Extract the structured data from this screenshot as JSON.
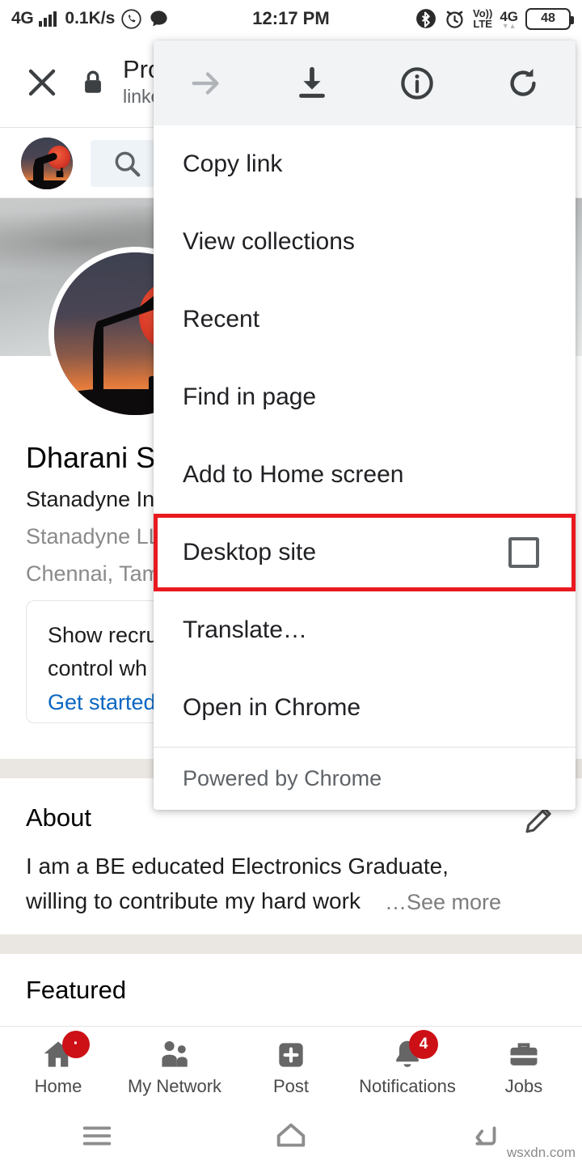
{
  "status_bar": {
    "network_type": "4G",
    "data_speed": "0.1K/s",
    "time": "12:17 PM",
    "volte_line1": "Vo))",
    "volte_line2": "LTE",
    "network_type_right": "4G",
    "battery_level": "48",
    "icons": [
      "signal-bars-icon",
      "whatsapp-icon",
      "message-bubble-icon",
      "bluetooth-icon",
      "alarm-clock-icon",
      "battery-icon"
    ]
  },
  "browser_header": {
    "close_label": "close-icon",
    "lock_label": "lock-icon",
    "page_title": "Pro",
    "page_url": "linke"
  },
  "menu": {
    "toolbar": [
      {
        "name": "forward-arrow-icon",
        "enabled": false
      },
      {
        "name": "download-icon",
        "enabled": true
      },
      {
        "name": "page-info-icon",
        "enabled": true
      },
      {
        "name": "refresh-icon",
        "enabled": true
      }
    ],
    "items": [
      {
        "label": "Copy link",
        "type": "item"
      },
      {
        "label": "View collections",
        "type": "item"
      },
      {
        "label": "Recent",
        "type": "item"
      },
      {
        "label": "Find in page",
        "type": "item"
      },
      {
        "label": "Add to Home screen",
        "type": "item"
      },
      {
        "label": "Desktop site",
        "type": "checkbox",
        "checked": false,
        "highlighted": true
      },
      {
        "label": "Translate…",
        "type": "item"
      },
      {
        "label": "Open in Chrome",
        "type": "item"
      }
    ],
    "footer": "Powered by Chrome",
    "highlight_color": "#e8191f"
  },
  "linkedin": {
    "search_placeholder": "search-icon",
    "profile": {
      "name": "Dharani S",
      "headline": "Stanadyne In",
      "company": "Stanadyne LL",
      "location": "Chennai, Tam"
    },
    "recruiter_card": {
      "line1": "Show recru",
      "line2": "control wh",
      "cta": "Get started"
    },
    "about": {
      "title": "About",
      "line1": "I am a BE educated Electronics Graduate,",
      "line2": "willing to contribute my hard work",
      "see_more": "…See more",
      "edit_icon": "pencil-icon"
    },
    "featured_title": "Featured",
    "bottom_nav": [
      {
        "label": "Home",
        "icon": "home-icon",
        "badge": "·"
      },
      {
        "label": "My Network",
        "icon": "people-icon",
        "badge": ""
      },
      {
        "label": "Post",
        "icon": "plus-square-icon",
        "badge": ""
      },
      {
        "label": "Notifications",
        "icon": "bell-icon",
        "badge": "4"
      },
      {
        "label": "Jobs",
        "icon": "briefcase-icon",
        "badge": ""
      }
    ],
    "badge_color": "#cc1016",
    "link_color": "#0a66c2"
  },
  "android_nav": {
    "items": [
      "menu-icon",
      "home-icon",
      "back-icon"
    ]
  },
  "watermark": "wsxdn.com"
}
